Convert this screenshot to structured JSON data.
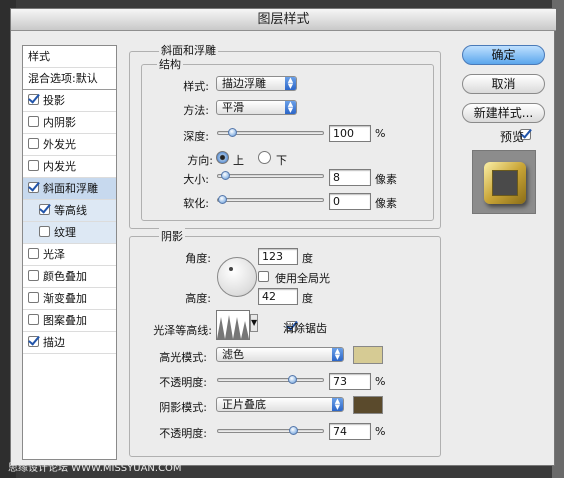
{
  "window": {
    "title": "图层样式"
  },
  "style_list": {
    "header": "样式",
    "blend": "混合选项:默认",
    "items": [
      {
        "label": "投影",
        "checked": true
      },
      {
        "label": "内阴影",
        "checked": false
      },
      {
        "label": "外发光",
        "checked": false
      },
      {
        "label": "内发光",
        "checked": false
      },
      {
        "label": "斜面和浮雕",
        "checked": true
      },
      {
        "label": "等高线",
        "checked": true
      },
      {
        "label": "纹理",
        "checked": false
      },
      {
        "label": "光泽",
        "checked": false
      },
      {
        "label": "颜色叠加",
        "checked": false
      },
      {
        "label": "渐变叠加",
        "checked": false
      },
      {
        "label": "图案叠加",
        "checked": false
      },
      {
        "label": "描边",
        "checked": true
      }
    ]
  },
  "bevel": {
    "title": "斜面和浮雕",
    "structure": {
      "title": "结构",
      "style_label": "样式:",
      "style_value": "描边浮雕",
      "method_label": "方法:",
      "method_value": "平滑",
      "depth_label": "深度:",
      "depth_value": "100",
      "depth_unit": "%",
      "depth_level": 0.1,
      "direction_label": "方向:",
      "dir_up": "上",
      "dir_down": "下",
      "size_label": "大小:",
      "size_value": "8",
      "size_unit": "像素",
      "size_level": 0.03,
      "soften_label": "软化:",
      "soften_value": "0",
      "soften_unit": "像素",
      "soften_level": 0.0
    },
    "shading": {
      "title": "阴影",
      "angle_label": "角度:",
      "angle_value": "123",
      "angle_unit": "度",
      "global_light": "使用全局光",
      "altitude_label": "高度:",
      "altitude_value": "42",
      "altitude_unit": "度",
      "gloss_label": "光泽等高线:",
      "antialias": "消除锯齿",
      "highlight_label": "高光模式:",
      "highlight_mode": "滤色",
      "highlight_color": "#d6cb94",
      "hl_opacity_label": "不透明度:",
      "hl_opacity_value": "73",
      "hl_opacity_unit": "%",
      "hl_opacity_level": 0.73,
      "shadow_label": "阴影模式:",
      "shadow_mode": "正片叠底",
      "shadow_color": "#5a4a2c",
      "sh_opacity_label": "不透明度:",
      "sh_opacity_value": "74",
      "sh_opacity_unit": "%",
      "sh_opacity_level": 0.74
    }
  },
  "buttons": {
    "ok": "确定",
    "cancel": "取消",
    "new_style": "新建样式...",
    "preview": "预览"
  },
  "watermark": "思缘设计论坛 WWW.MISSYUAN.COM"
}
